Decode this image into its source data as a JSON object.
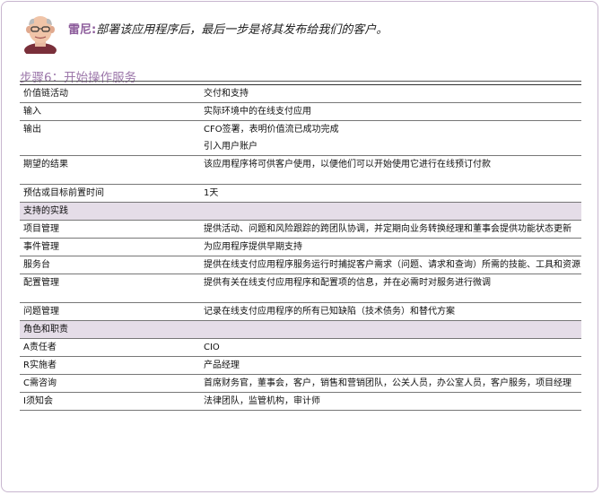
{
  "intro": {
    "speaker": "雷尼",
    "sep": ":",
    "text": "部署该应用程序后，最后一步是将其发布给我们的客户。"
  },
  "step_title": "步骤6：开始操作服务",
  "rows": [
    {
      "type": "row",
      "label": "价值链活动",
      "value": "交付和支持"
    },
    {
      "type": "row",
      "label": "输入",
      "value": "实际环境中的在线支付应用"
    },
    {
      "type": "row",
      "label": "输出",
      "value": "CFO签署，表明价值流已成功完成\n引入用户账户"
    },
    {
      "type": "row",
      "label": "期望的结果",
      "value": "该应用程序将可供客户使用，以便他们可以开始使用它进行在线预订付款",
      "gap": true
    },
    {
      "type": "row",
      "label": "预估或目标前置时间",
      "value": "1天"
    },
    {
      "type": "section",
      "label": "支持的实践"
    },
    {
      "type": "row",
      "label": "项目管理",
      "value": "提供活动、问题和风险跟踪的跨团队协调，并定期向业务转换经理和董事会提供功能状态更新"
    },
    {
      "type": "row",
      "label": "事件管理",
      "value": "为应用程序提供早期支持"
    },
    {
      "type": "row",
      "label": "服务台",
      "value": "提供在线支付应用程序服务运行时捕捉客户需求（问题、请求和查询）所需的技能、工具和资源"
    },
    {
      "type": "row",
      "label": "配置管理",
      "value": "提供有关在线支付应用程序和配置项的信息，并在必需时对服务进行微调",
      "gap": true
    },
    {
      "type": "row",
      "label": "问题管理",
      "value": "记录在线支付应用程序的所有已知缺陷（技术债务）和替代方案"
    },
    {
      "type": "section",
      "label": "角色和职责"
    },
    {
      "type": "row",
      "label": "A责任者",
      "value": "CIO"
    },
    {
      "type": "row",
      "label": "R实施者",
      "value": "产品经理"
    },
    {
      "type": "row",
      "label": "C需咨询",
      "value": "首席财务官，董事会，客户，销售和营销团队，公关人员，办公室人员，客户服务，项目经理"
    },
    {
      "type": "row",
      "label": "I须知会",
      "value": "法律团队，监管机构，审计师"
    }
  ]
}
